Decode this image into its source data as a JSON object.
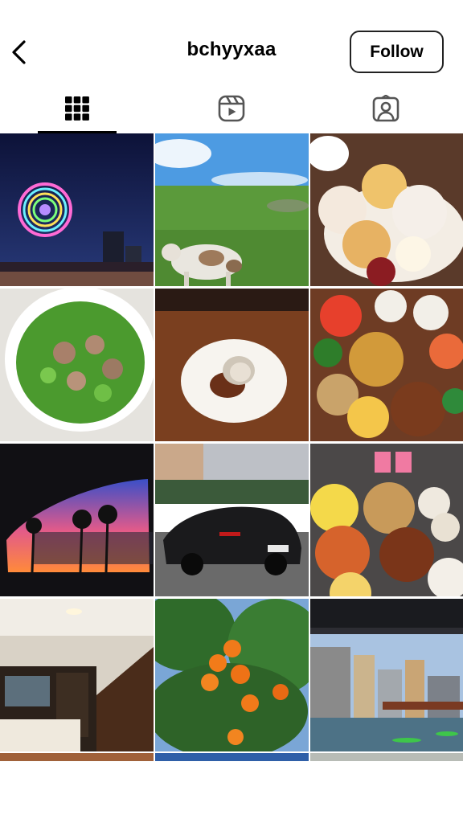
{
  "header": {
    "username": "bchyyxaa",
    "follow_label": "Follow",
    "back_icon": "chevron-left-icon"
  },
  "tabs": [
    {
      "name": "posts",
      "icon": "grid-icon",
      "active": true
    },
    {
      "name": "reels",
      "icon": "reels-icon",
      "active": false
    },
    {
      "name": "tagged",
      "icon": "tagged-person-icon",
      "active": false
    }
  ],
  "grid": {
    "posts": [
      {
        "subject": "ferris-wheel-night"
      },
      {
        "subject": "cow-on-green-hill"
      },
      {
        "subject": "scones-and-cream"
      },
      {
        "subject": "minced-meat-greens-bowl"
      },
      {
        "subject": "clam-dish"
      },
      {
        "subject": "banquet-table-dishes"
      },
      {
        "subject": "sunset-through-car-window"
      },
      {
        "subject": "black-sports-car"
      },
      {
        "subject": "dinner-table-spread"
      },
      {
        "subject": "living-room-staircase"
      },
      {
        "subject": "tangerine-tree"
      },
      {
        "subject": "river-kayaks-city"
      }
    ]
  },
  "colors": {
    "text": "#000000",
    "border": "#222222",
    "inactive_icon": "#555555",
    "background": "#ffffff"
  }
}
